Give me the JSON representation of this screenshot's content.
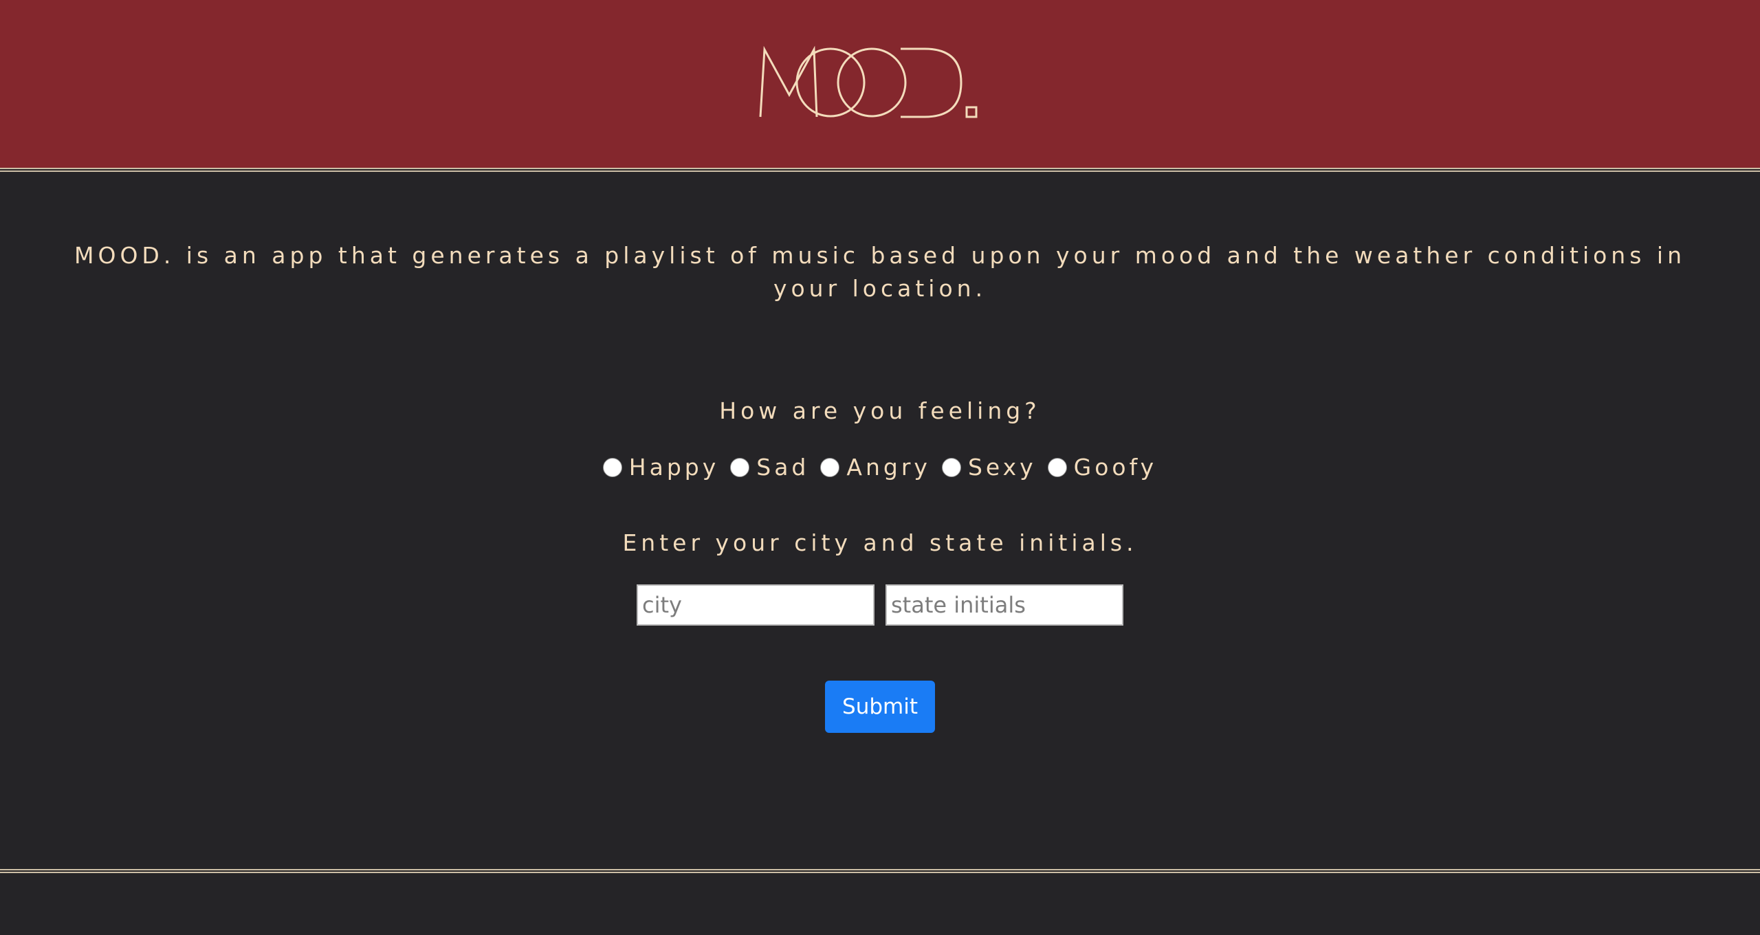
{
  "header": {
    "logo_text": "MOOD.",
    "background_color": "#84272d"
  },
  "intro": {
    "text": "MOOD. is an app that generates a playlist of music based upon your mood and the weather conditions in your location."
  },
  "mood_section": {
    "question": "How are you feeling?",
    "options": [
      "Happy",
      "Sad",
      "Angry",
      "Sexy",
      "Goofy"
    ]
  },
  "location_section": {
    "prompt": "Enter your city and state initials.",
    "city_placeholder": "city",
    "state_placeholder": "state initials"
  },
  "submit_label": "Submit",
  "colors": {
    "text": "#f3dcbc",
    "background": "#252427",
    "button": "#1a7cf5",
    "rule": "#cdbfa6"
  }
}
